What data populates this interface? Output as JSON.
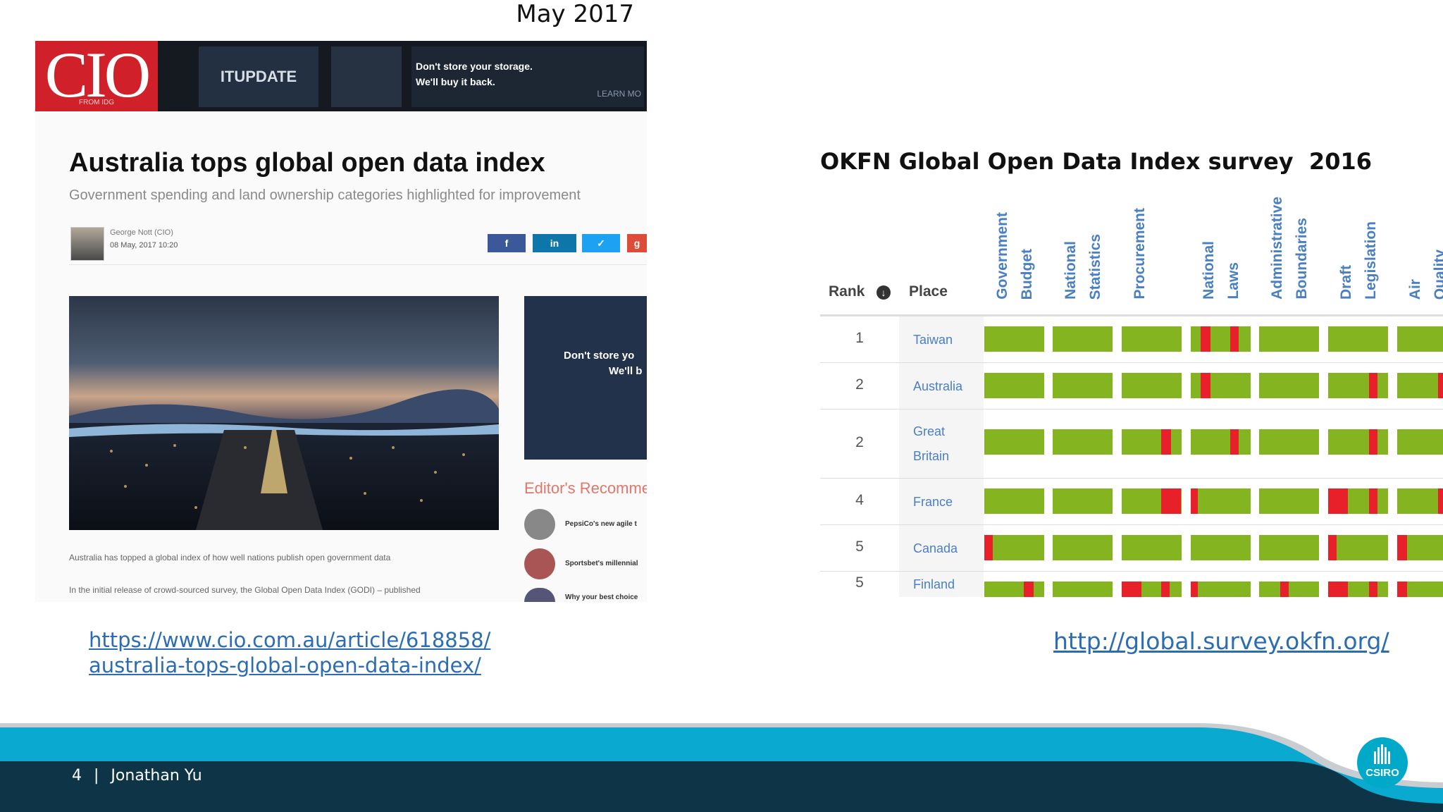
{
  "header": {
    "date": "May 2017"
  },
  "article": {
    "banner": {
      "logo": "CIO",
      "logo_sub": "FROM IDG",
      "itupdate": "ITUPDATE",
      "ad_line1": "Don't store your storage.",
      "ad_line2": "We'll buy it back.",
      "ad_cta": "LEARN MO"
    },
    "title": "Australia tops global open data index",
    "subtitle": "Government spending and land ownership categories highlighted for improvement",
    "author": "George Nott (CIO)",
    "date": "08 May, 2017 10:20",
    "share": {
      "facebook": "f",
      "linkedin": "in",
      "twitter": "✓",
      "google": "g"
    },
    "side_ad_line1": "Don't store yo",
    "side_ad_line2": "We'll b",
    "editors_heading": "Editor's Recomme",
    "recommendations": [
      "PepsiCo's new agile t",
      "Sportsbet's millennial",
      "Why your best choice"
    ],
    "body_lines": [
      "Australia has topped a global index of how well nations publish open government data",
      "In the initial release of crowd-sourced survey, the Global Open Data Index (GODI) – published"
    ]
  },
  "okfn": {
    "title": "OKFN Global Open Data Index survey  2016",
    "rank_header": "Rank",
    "place_header": "Place",
    "columns": [
      [
        "Government",
        "Budget"
      ],
      [
        "National",
        "Statistics"
      ],
      [
        "Procurement"
      ],
      [
        "National",
        "Laws"
      ],
      [
        "Administrative",
        "Boundaries"
      ],
      [
        "Draft",
        "Legislation"
      ],
      [
        "Air",
        "Quality"
      ]
    ],
    "rows": [
      {
        "rank": "1",
        "place": [
          "Taiwan"
        ]
      },
      {
        "rank": "2",
        "place": [
          "Australia"
        ]
      },
      {
        "rank": "2",
        "place": [
          "Great",
          "Britain"
        ]
      },
      {
        "rank": "4",
        "place": [
          "France"
        ]
      },
      {
        "rank": "5",
        "place": [
          "Canada"
        ]
      },
      {
        "rank": "5",
        "place": [
          "Finland"
        ]
      }
    ],
    "colors": {
      "green": "#84b520",
      "red": "#e8202a"
    }
  },
  "links": {
    "cio_line1": "https://www.cio.com.au/article/618858/",
    "cio_line2": "australia-tops-global-open-data-index/",
    "okfn": "http://global.survey.okfn.org/"
  },
  "footer": {
    "page": "4",
    "separator": "|",
    "author": "Jonathan Yu",
    "logo": "CSIRO",
    "colors": {
      "band_light": "#0aa9cf",
      "band_dark": "#0d3447"
    }
  }
}
